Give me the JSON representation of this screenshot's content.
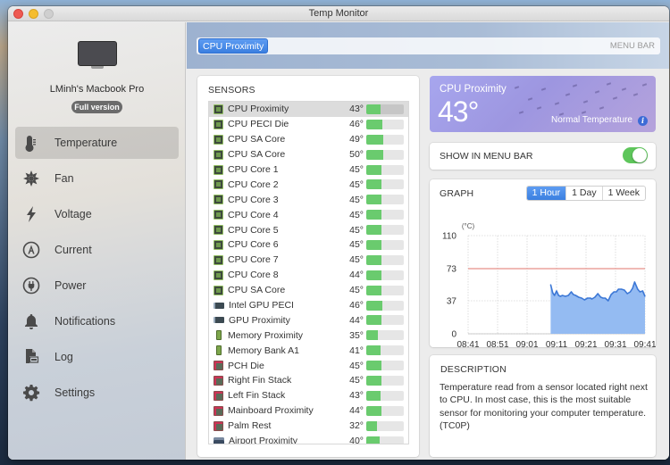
{
  "window": {
    "title": "Temp Monitor"
  },
  "sidebar": {
    "device_name": "LMinh's Macbook Pro",
    "badge": "Full version",
    "items": [
      {
        "label": "Temperature",
        "icon": "thermometer-icon",
        "active": true
      },
      {
        "label": "Fan",
        "icon": "fan-icon",
        "active": false
      },
      {
        "label": "Voltage",
        "icon": "lightning-icon",
        "active": false
      },
      {
        "label": "Current",
        "icon": "ampere-icon",
        "active": false
      },
      {
        "label": "Power",
        "icon": "plug-icon",
        "active": false
      },
      {
        "label": "Notifications",
        "icon": "bell-icon",
        "active": false
      },
      {
        "label": "Log",
        "icon": "log-file-icon",
        "active": false
      },
      {
        "label": "Settings",
        "icon": "gear-icon",
        "active": false
      }
    ]
  },
  "menubar": {
    "selected_chip": "CPU Proximity",
    "label": "MENU BAR"
  },
  "sensors": {
    "title": "SENSORS",
    "max_temp": 110,
    "items": [
      {
        "name": "CPU Proximity",
        "value": "43°",
        "temp": 43,
        "type": "cpu",
        "selected": true
      },
      {
        "name": "CPU PECI Die",
        "value": "46°",
        "temp": 46,
        "type": "cpu"
      },
      {
        "name": "CPU SA Core",
        "value": "49°",
        "temp": 49,
        "type": "cpu"
      },
      {
        "name": "CPU SA Core",
        "value": "50°",
        "temp": 50,
        "type": "cpu"
      },
      {
        "name": "CPU Core 1",
        "value": "45°",
        "temp": 45,
        "type": "cpu"
      },
      {
        "name": "CPU Core 2",
        "value": "45°",
        "temp": 45,
        "type": "cpu"
      },
      {
        "name": "CPU Core 3",
        "value": "45°",
        "temp": 45,
        "type": "cpu"
      },
      {
        "name": "CPU Core 4",
        "value": "45°",
        "temp": 45,
        "type": "cpu"
      },
      {
        "name": "CPU Core 5",
        "value": "45°",
        "temp": 45,
        "type": "cpu"
      },
      {
        "name": "CPU Core 6",
        "value": "45°",
        "temp": 45,
        "type": "cpu"
      },
      {
        "name": "CPU Core 7",
        "value": "45°",
        "temp": 45,
        "type": "cpu"
      },
      {
        "name": "CPU Core 8",
        "value": "44°",
        "temp": 44,
        "type": "cpu"
      },
      {
        "name": "CPU SA Core",
        "value": "45°",
        "temp": 45,
        "type": "cpu"
      },
      {
        "name": "Intel GPU PECI",
        "value": "46°",
        "temp": 46,
        "type": "gpu"
      },
      {
        "name": "GPU Proximity",
        "value": "44°",
        "temp": 44,
        "type": "gpu"
      },
      {
        "name": "Memory Proximity",
        "value": "35°",
        "temp": 35,
        "type": "mem"
      },
      {
        "name": "Memory Bank A1",
        "value": "41°",
        "temp": 41,
        "type": "mem"
      },
      {
        "name": "PCH Die",
        "value": "45°",
        "temp": 45,
        "type": "board"
      },
      {
        "name": "Right Fin Stack",
        "value": "45°",
        "temp": 45,
        "type": "board"
      },
      {
        "name": "Left Fin Stack",
        "value": "43°",
        "temp": 43,
        "type": "board"
      },
      {
        "name": "Mainboard Proximity",
        "value": "44°",
        "temp": 44,
        "type": "board"
      },
      {
        "name": "Palm Rest",
        "value": "32°",
        "temp": 32,
        "type": "board"
      },
      {
        "name": "Airport Proximity",
        "value": "40°",
        "temp": 40,
        "type": "air"
      }
    ]
  },
  "hero": {
    "sensor_name": "CPU Proximity",
    "temperature": "43°",
    "status": "Normal Temperature",
    "info_glyph": "i"
  },
  "show_in_menubar": {
    "label": "SHOW IN MENU BAR",
    "enabled": true
  },
  "graph": {
    "title": "GRAPH",
    "ranges": [
      {
        "label": "1 Hour",
        "active": true
      },
      {
        "label": "1 Day",
        "active": false
      },
      {
        "label": "1 Week",
        "active": false
      }
    ]
  },
  "description": {
    "title": "DESCRIPTION",
    "text": "Temperature read from a sensor located right next to CPU. In most case, this is the most suitable sensor for monitoring your computer temperature. (TC0P)"
  },
  "colors": {
    "accent": "#3b7fe0",
    "bar_fill": "#6acb6e",
    "toggle_on": "#5ec65b",
    "threshold_line": "#e0756b",
    "area_fill": "#94bbf2",
    "area_line": "#3d78d6"
  },
  "chart_data": {
    "type": "area",
    "title": "",
    "ylabel": "(°C)",
    "xlabel": "",
    "x_ticks": [
      "08:41",
      "08:51",
      "09:01",
      "09:11",
      "09:21",
      "09:31",
      "09:41"
    ],
    "y_ticks": [
      0,
      37,
      73,
      110
    ],
    "xlim_minutes": [
      0,
      60
    ],
    "ylim": [
      0,
      110
    ],
    "grid": true,
    "threshold": 73,
    "series": [
      {
        "name": "CPU Proximity",
        "x_minutes": [
          28,
          28.7,
          29.3,
          30,
          30.7,
          31.3,
          32,
          33,
          34,
          35,
          35.7,
          36.5,
          37.5,
          38.5,
          39.5,
          40.5,
          41.5,
          42,
          43,
          44,
          45,
          45.8,
          46.5,
          47.5,
          48.5,
          49.5,
          50.3,
          51,
          52,
          53,
          54,
          55,
          55.8,
          56.5,
          57.5,
          58.3,
          59.2,
          60
        ],
        "values": [
          55,
          46,
          43,
          48,
          43,
          42,
          43,
          42,
          43,
          47,
          44,
          43,
          41,
          40,
          38,
          40,
          40,
          39,
          41,
          45,
          41,
          40,
          40,
          37,
          44,
          47,
          47,
          50,
          50,
          49,
          45,
          47,
          51,
          58,
          50,
          47,
          48,
          42
        ]
      }
    ]
  }
}
